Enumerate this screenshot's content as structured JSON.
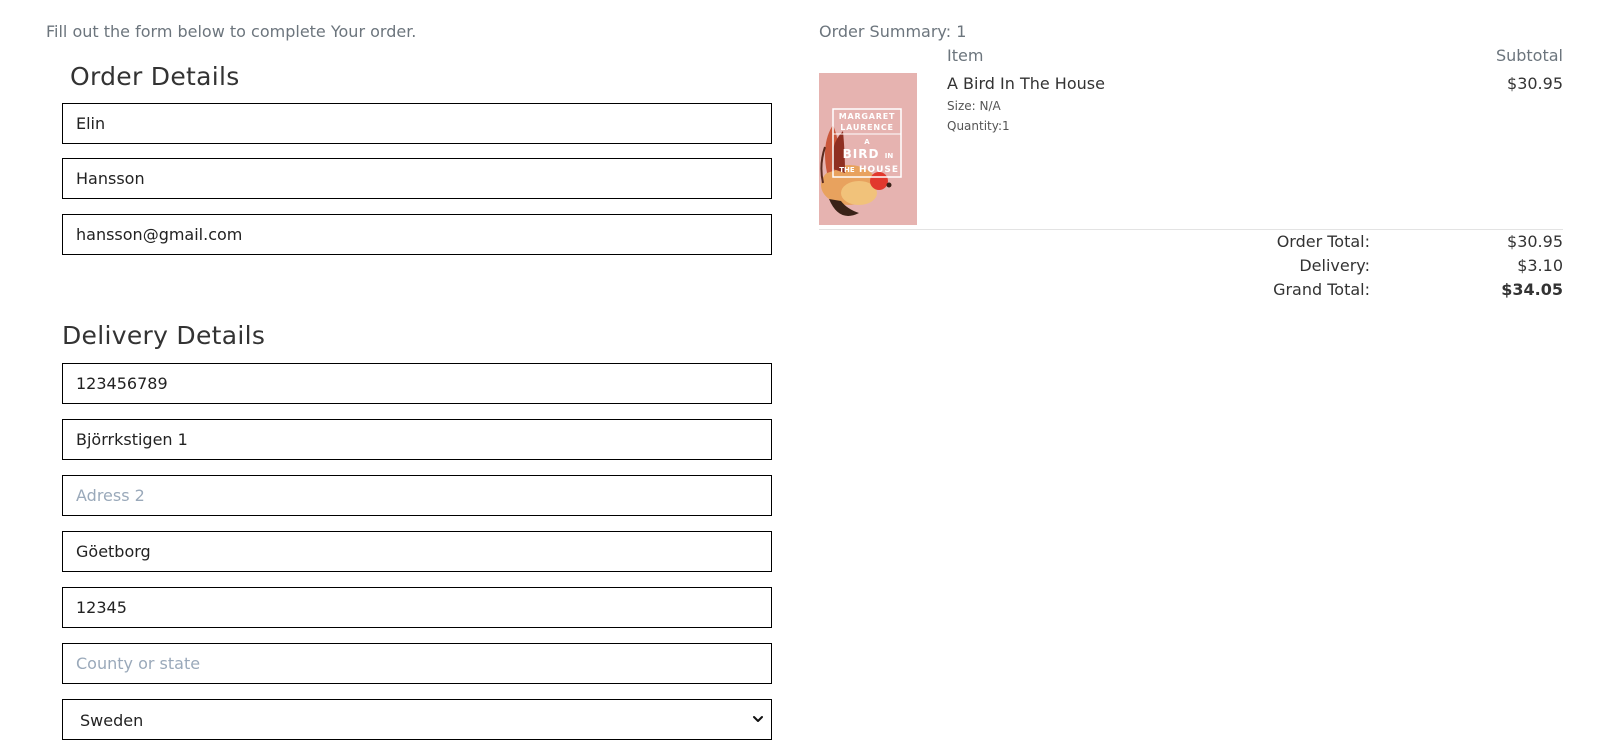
{
  "intro_text": "Fill out the form below to complete Your order.",
  "order_details": {
    "title": "Order Details",
    "first_name": "Elin",
    "last_name": "Hansson",
    "email": "hansson@gmail.com"
  },
  "delivery_details": {
    "title": "Delivery Details",
    "phone": "123456789",
    "address1": "Björrkstigen 1",
    "address2_placeholder": "Adress 2",
    "city": "Göetborg",
    "postcode": "12345",
    "county_placeholder": "County or state",
    "country": "Sweden"
  },
  "summary": {
    "title": "Order Summary: 1",
    "col_item": "Item",
    "col_subtotal": "Subtotal",
    "item": {
      "name": "A Bird In The House",
      "size": "Size: N/A",
      "quantity": "Quantity:1",
      "subtotal": "$30.95",
      "cover": {
        "author_line1": "MARGARET",
        "author_line2": "LAURENCE",
        "title_a": "A",
        "title_bird": "BIRD",
        "title_in": "IN",
        "title_the": "THE",
        "title_house": "HOUSE",
        "background_color": "#e6b3b0"
      }
    },
    "order_total_label": "Order Total:",
    "order_total_value": "$30.95",
    "delivery_label": "Delivery:",
    "delivery_value": "$3.10",
    "grand_total_label": "Grand Total:",
    "grand_total_value": "$34.05"
  },
  "colors": {
    "muted_text": "#6c757d",
    "placeholder": "#9aa9ba",
    "input_border": "#000000"
  }
}
